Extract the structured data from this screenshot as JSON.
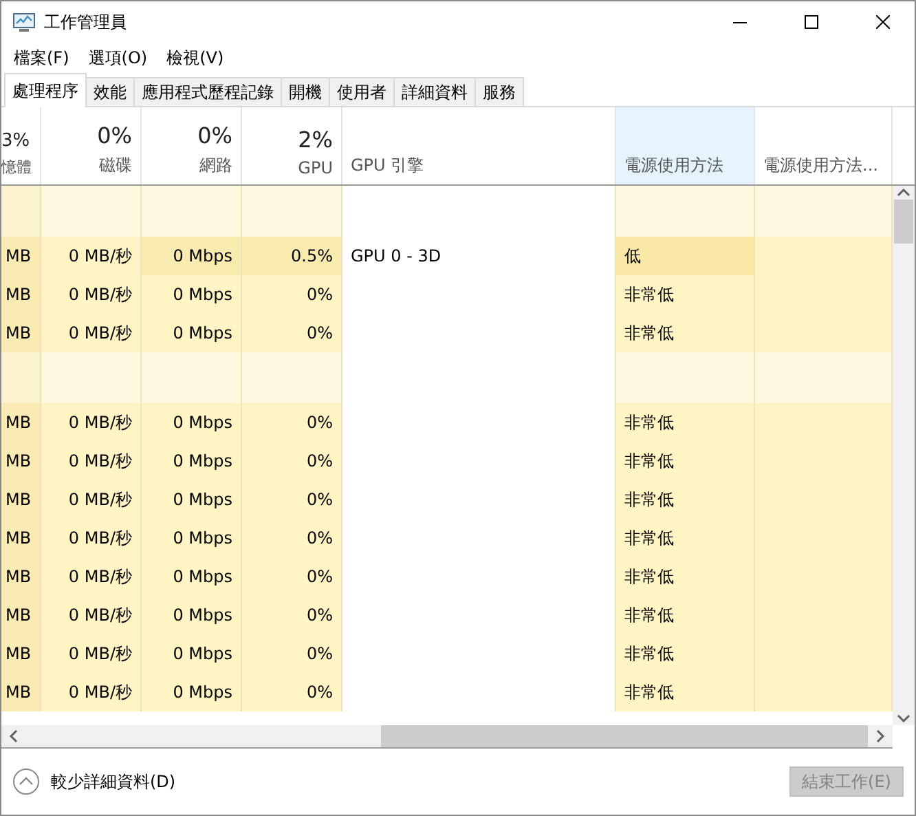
{
  "window": {
    "title": "工作管理員"
  },
  "menu": [
    "檔案(F)",
    "選項(O)",
    "檢視(V)"
  ],
  "tabs": [
    {
      "label": "處理程序",
      "selected": true
    },
    {
      "label": "效能",
      "selected": false
    },
    {
      "label": "應用程式歷程記錄",
      "selected": false
    },
    {
      "label": "開機",
      "selected": false
    },
    {
      "label": "使用者",
      "selected": false
    },
    {
      "label": "詳細資料",
      "selected": false
    },
    {
      "label": "服務",
      "selected": false
    }
  ],
  "table": {
    "columns": [
      {
        "value": "3%",
        "label": "憶體",
        "selected": false
      },
      {
        "value": "0%",
        "label": "磁碟",
        "selected": false
      },
      {
        "value": "0%",
        "label": "網路",
        "selected": false
      },
      {
        "value": "2%",
        "label": "GPU",
        "selected": false
      },
      {
        "label": "GPU 引擎",
        "selected": false
      },
      {
        "label": "電源使用方法",
        "selected": true
      },
      {
        "label": "電源使用方法...",
        "selected": false
      }
    ],
    "rows": [
      {
        "kind": "group"
      },
      {
        "kind": "process",
        "cells": [
          {
            "text": "MB",
            "color": "#f9ebb3"
          },
          {
            "text": "0 MB/秒",
            "color": "#fff4c4"
          },
          {
            "text": "0 Mbps",
            "color": "#f9eab0"
          },
          {
            "text": "0.5%",
            "color": "#f9eab0"
          },
          {
            "text": "GPU 0 - 3D",
            "color": "#ffffff"
          },
          {
            "text": "低",
            "color": "#f9e8a6"
          },
          {
            "color": "#fff4c4"
          }
        ]
      },
      {
        "kind": "process",
        "cells": [
          {
            "text": "MB",
            "color": "#f9ebb3"
          },
          {
            "text": "0 MB/秒",
            "color": "#fff4c4"
          },
          {
            "text": "0 Mbps",
            "color": "#fff4c4"
          },
          {
            "text": "0%",
            "color": "#fff4c4"
          },
          {
            "color": "#ffffff"
          },
          {
            "text": "非常低",
            "color": "#fff4c4"
          },
          {
            "color": "#fff4c4"
          }
        ]
      },
      {
        "kind": "process",
        "cells": [
          {
            "text": "MB",
            "color": "#f9ebb3"
          },
          {
            "text": "0 MB/秒",
            "color": "#fff4c4"
          },
          {
            "text": "0 Mbps",
            "color": "#fff4c4"
          },
          {
            "text": "0%",
            "color": "#fff4c4"
          },
          {
            "color": "#ffffff"
          },
          {
            "text": "非常低",
            "color": "#fff4c4"
          },
          {
            "color": "#fff4c4"
          }
        ]
      },
      {
        "kind": "group"
      },
      {
        "kind": "process",
        "cells": [
          {
            "text": "MB",
            "color": "#f9ebb3"
          },
          {
            "text": "0 MB/秒",
            "color": "#fff4c4"
          },
          {
            "text": "0 Mbps",
            "color": "#fff4c4"
          },
          {
            "text": "0%",
            "color": "#fff4c4"
          },
          {
            "color": "#ffffff"
          },
          {
            "text": "非常低",
            "color": "#fff4c4"
          },
          {
            "color": "#fff4c4"
          }
        ]
      },
      {
        "kind": "process",
        "cells": [
          {
            "text": "MB",
            "color": "#f9ebb3"
          },
          {
            "text": "0 MB/秒",
            "color": "#fff4c4"
          },
          {
            "text": "0 Mbps",
            "color": "#fff4c4"
          },
          {
            "text": "0%",
            "color": "#fff4c4"
          },
          {
            "color": "#ffffff"
          },
          {
            "text": "非常低",
            "color": "#fff4c4"
          },
          {
            "color": "#fff4c4"
          }
        ]
      },
      {
        "kind": "process",
        "cells": [
          {
            "text": "MB",
            "color": "#f9ebb3"
          },
          {
            "text": "0 MB/秒",
            "color": "#fff4c4"
          },
          {
            "text": "0 Mbps",
            "color": "#fff4c4"
          },
          {
            "text": "0%",
            "color": "#fff4c4"
          },
          {
            "color": "#ffffff"
          },
          {
            "text": "非常低",
            "color": "#fff4c4"
          },
          {
            "color": "#fff4c4"
          }
        ]
      },
      {
        "kind": "process",
        "cells": [
          {
            "text": "MB",
            "color": "#f9ebb3"
          },
          {
            "text": "0 MB/秒",
            "color": "#fff4c4"
          },
          {
            "text": "0 Mbps",
            "color": "#fff4c4"
          },
          {
            "text": "0%",
            "color": "#fff4c4"
          },
          {
            "color": "#ffffff"
          },
          {
            "text": "非常低",
            "color": "#fff4c4"
          },
          {
            "color": "#fff4c4"
          }
        ]
      },
      {
        "kind": "process",
        "cells": [
          {
            "text": "MB",
            "color": "#f9ebb3"
          },
          {
            "text": "0 MB/秒",
            "color": "#fff4c4"
          },
          {
            "text": "0 Mbps",
            "color": "#fff4c4"
          },
          {
            "text": "0%",
            "color": "#fff4c4"
          },
          {
            "color": "#ffffff"
          },
          {
            "text": "非常低",
            "color": "#fff4c4"
          },
          {
            "color": "#fff4c4"
          }
        ]
      },
      {
        "kind": "process",
        "cells": [
          {
            "text": "MB",
            "color": "#f9ebb3"
          },
          {
            "text": "0 MB/秒",
            "color": "#fff4c4"
          },
          {
            "text": "0 Mbps",
            "color": "#fff4c4"
          },
          {
            "text": "0%",
            "color": "#fff4c4"
          },
          {
            "color": "#ffffff"
          },
          {
            "text": "非常低",
            "color": "#fff4c4"
          },
          {
            "color": "#fff4c4"
          }
        ]
      },
      {
        "kind": "process",
        "cells": [
          {
            "text": "MB",
            "color": "#f9ebb3"
          },
          {
            "text": "0 MB/秒",
            "color": "#fff4c4"
          },
          {
            "text": "0 Mbps",
            "color": "#fff4c4"
          },
          {
            "text": "0%",
            "color": "#fff4c4"
          },
          {
            "color": "#ffffff"
          },
          {
            "text": "非常低",
            "color": "#fff4c4"
          },
          {
            "color": "#fff4c4"
          }
        ]
      },
      {
        "kind": "process",
        "cells": [
          {
            "text": "MB",
            "color": "#f9ebb3"
          },
          {
            "text": "0 MB/秒",
            "color": "#fff4c4"
          },
          {
            "text": "0 Mbps",
            "color": "#fff4c4"
          },
          {
            "text": "0%",
            "color": "#fff4c4"
          },
          {
            "color": "#ffffff"
          },
          {
            "text": "非常低",
            "color": "#fff4c4"
          },
          {
            "color": "#fff4c4"
          }
        ]
      }
    ]
  },
  "footer": {
    "toggle": "較少詳細資料(D)",
    "button": {
      "label": "結束工作(E)",
      "disabled": true
    }
  }
}
